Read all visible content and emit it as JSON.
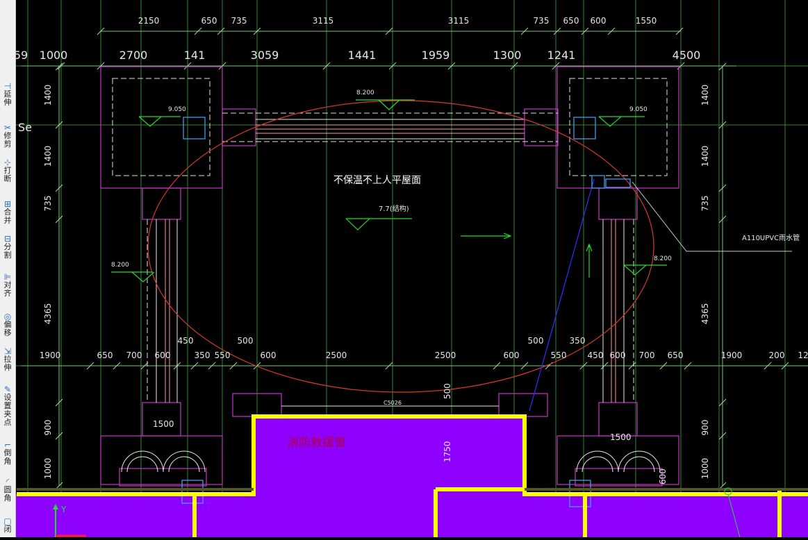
{
  "toolbar": {
    "items": [
      {
        "label": "延伸",
        "icon": "extend-icon"
      },
      {
        "label": "修剪",
        "icon": "trim-icon"
      },
      {
        "label": "打断",
        "icon": "break-icon"
      },
      {
        "label": "合并",
        "icon": "join-icon"
      },
      {
        "label": "分割",
        "icon": "split-icon"
      },
      {
        "label": "对齐",
        "icon": "align-icon"
      },
      {
        "label": "偏移",
        "icon": "offset-icon"
      },
      {
        "label": "拉伸",
        "icon": "stretch-icon"
      },
      {
        "label": "设置夹点",
        "icon": "grip-icon"
      },
      {
        "label": "倒角",
        "icon": "chamfer-icon"
      },
      {
        "label": "圆角",
        "icon": "fillet-icon"
      },
      {
        "label": "闭",
        "icon": "close-icon"
      }
    ]
  },
  "drawing": {
    "top_dims_1": [
      "2150",
      "650",
      "735",
      "3115",
      "3115",
      "735",
      "650",
      "600",
      "1550"
    ],
    "top_dims_2": [
      "59",
      "1000",
      "2700",
      "141",
      "3059",
      "1441",
      "1959",
      "1300",
      "1241",
      "4500"
    ],
    "mid_dims": [
      "1900",
      "650",
      "700",
      "600",
      "350",
      "550",
      "600",
      "2500",
      "2500",
      "600",
      "550",
      "450",
      "600",
      "700",
      "650",
      "1900",
      "200",
      "12"
    ],
    "mid_dims_upper": [
      "450",
      "500",
      "500",
      "350"
    ],
    "left_dims": [
      "1400",
      "1400",
      "735",
      "4365",
      "900",
      "1000"
    ],
    "right_dims": [
      "1400",
      "1400",
      "735",
      "4365",
      "900",
      "1000"
    ],
    "roof_label": "不保温不上人平屋面",
    "level_77": "7.7(结构)",
    "level_8200_top": "8.200",
    "level_8200_left": "8.200",
    "level_8200_right": "8.200",
    "level_9050_left": "9.050",
    "level_9050_right": "9.050",
    "pipe_label": "A110UPVC雨水管",
    "window_label": "消防救援窗",
    "window_code": "C5026",
    "dim_1500_left": "1500",
    "dim_1500_right": "1500",
    "dim_500_v": "500",
    "dim_1750_v": "1750",
    "dim_600_v": "600",
    "stray_text": "Se",
    "ucs_y": "Y"
  },
  "colors": {
    "background": "#000000",
    "magenta": "#cc33cc",
    "green_grid": "#2f8a2f",
    "dim_text": "#e6e6e6",
    "yellow": "#ffff00",
    "purple_fill": "#8e00ff",
    "red": "#d83a2a",
    "blue": "#2f2fff",
    "cyan": "#3fa9ff",
    "window_label": "#b00040"
  }
}
